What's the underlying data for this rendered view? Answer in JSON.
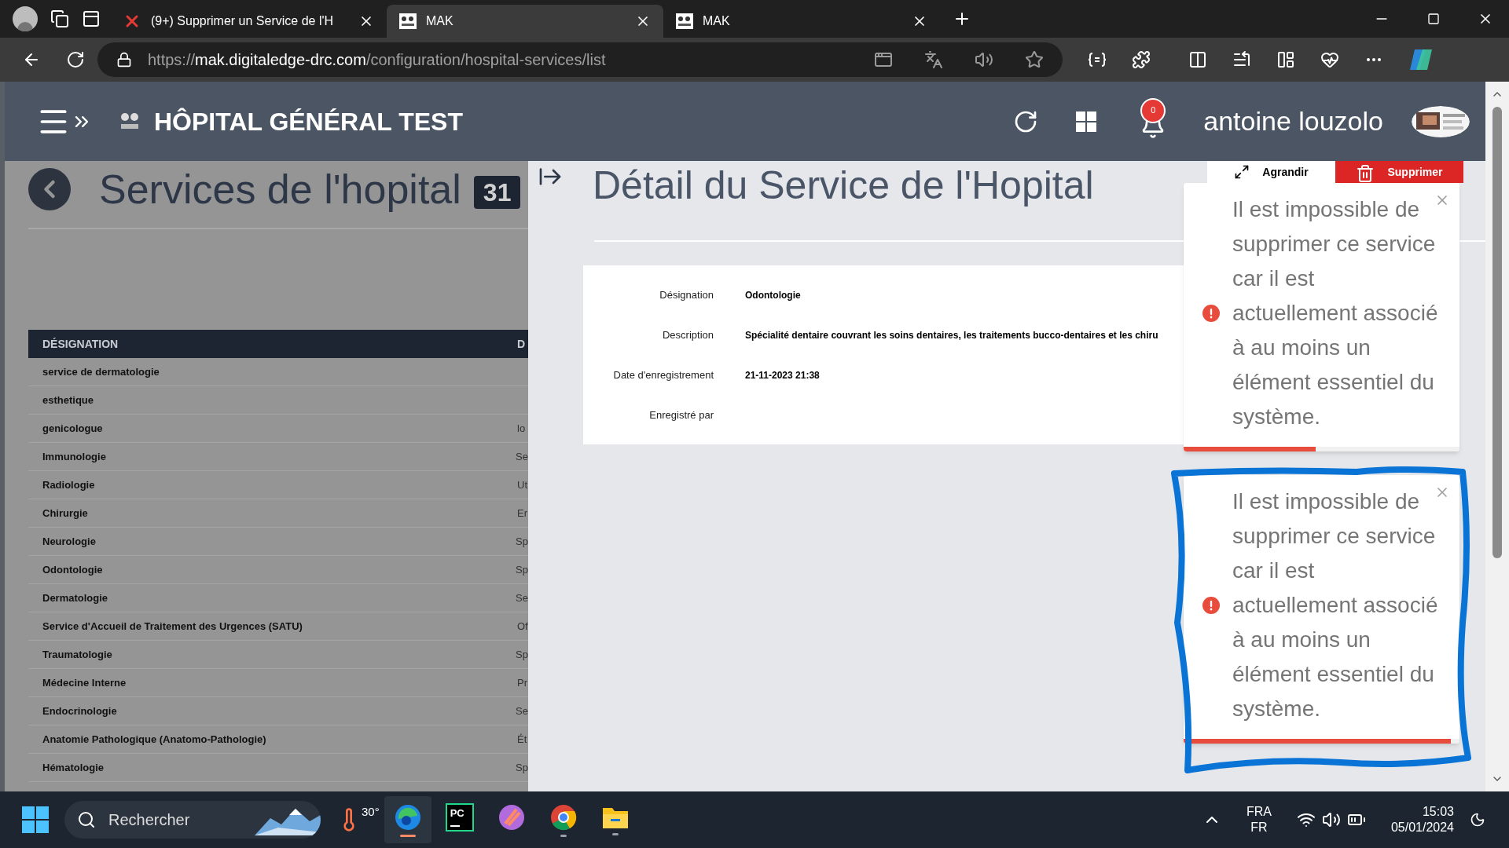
{
  "browser": {
    "tabs": [
      {
        "title": "(9+) Supprimer un Service de l'H",
        "selected": false,
        "kind": "error"
      },
      {
        "title": "MAK",
        "selected": true,
        "kind": "site"
      },
      {
        "title": "MAK",
        "selected": false,
        "kind": "site"
      }
    ],
    "address": {
      "scheme": "https://",
      "host": "mak.digitaledge-drc.com",
      "path": "/configuration/hospital-services/list"
    }
  },
  "header": {
    "title": "HÔPITAL GÉNÉRAL TEST",
    "notifications": "0",
    "user": "antoine louzolo"
  },
  "list": {
    "title": "Services de l'hopital",
    "count": "31",
    "columns": [
      "DÉSIGNATION",
      "D"
    ],
    "rows": [
      {
        "designation": "service de dermatologie"
      },
      {
        "designation": "esthetique"
      },
      {
        "designation": "genicologue",
        "column_2": "lo"
      },
      {
        "designation": "Immunologie",
        "column_2": "Se"
      },
      {
        "designation": "Radiologie",
        "column_2": "Ut"
      },
      {
        "designation": "Chirurgie",
        "column_2": "Er"
      },
      {
        "designation": "Neurologie",
        "column_2": "Sp"
      },
      {
        "designation": "Odontologie",
        "column_2": "Sp"
      },
      {
        "designation": "Dermatologie",
        "column_2": "Se"
      },
      {
        "designation": "Service d'Accueil de Traitement des Urgences (SATU)",
        "column_2": "Of"
      },
      {
        "designation": "Traumatologie",
        "column_2": "Sp"
      },
      {
        "designation": "Médecine Interne",
        "column_2": "Pr"
      },
      {
        "designation": "Endocrinologie",
        "column_2": "Se"
      },
      {
        "designation": "Anatomie Pathologique (Anatomo-Pathologie)",
        "column_2": "Ét"
      },
      {
        "designation": "Hématologie",
        "column_2": "Sp"
      }
    ]
  },
  "detail": {
    "title": "Détail du Service de l'Hopital",
    "actions": [
      {
        "label": "Agrandir",
        "kind": "expand"
      },
      {
        "label": "Supprimer",
        "kind": "delete"
      }
    ],
    "fields": [
      {
        "label": "Désignation",
        "value": "Odontologie"
      },
      {
        "label": "Description",
        "value": "Spécialité dentaire couvrant les soins dentaires, les traitements bucco-dentaires et les chiru"
      },
      {
        "label": "Date d'enregistrement",
        "value": "21-11-2023 21:38"
      },
      {
        "label": "Enregistré par"
      }
    ]
  },
  "toasts": [
    {
      "message": "Il est impossible de supprimer ce service car il est actuellement associé à au moins un élément essentiel du système.",
      "level": 0.48,
      "annotated": false
    },
    {
      "message": "Il est impossible de supprimer ce service car il est actuellement associé à au moins un élément essentiel du système.",
      "level": 0.97,
      "annotated": true
    }
  ],
  "taskbar": {
    "search_placeholder": "Rechercher",
    "temperature": "30°",
    "apps": [
      {
        "kind": "edge",
        "active": true,
        "running": true
      },
      {
        "kind": "pycharm",
        "label": "PC",
        "active": false,
        "running": false
      },
      {
        "kind": "sketch",
        "active": false,
        "running": false
      },
      {
        "kind": "chrome",
        "active": false,
        "running": true
      },
      {
        "kind": "files",
        "active": false,
        "running": true
      }
    ],
    "language": [
      "FRA",
      "FR"
    ],
    "time": "15:03",
    "date": "05/01/2024"
  }
}
